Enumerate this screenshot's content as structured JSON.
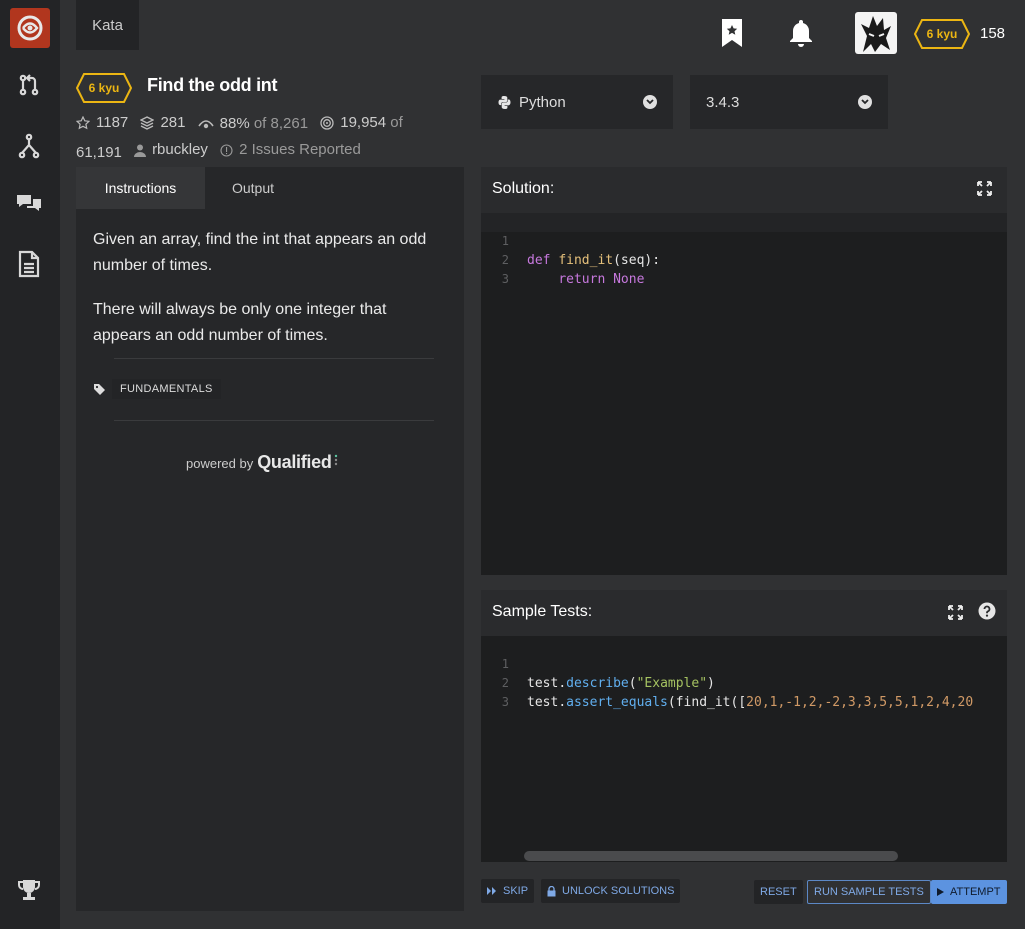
{
  "nav": {
    "kata_tab": "Kata",
    "honor": "158",
    "user_rank": "6 kyu"
  },
  "kata": {
    "rank": "6 kyu",
    "title": "Find the odd int",
    "stars": "1187",
    "collections": "281",
    "satisfaction": "88%",
    "satisfaction_of": "of 8,261",
    "completed": "19,954",
    "completed_of": "of",
    "total_attempts": "61,191",
    "author": "rbuckley",
    "issues": "2 Issues Reported"
  },
  "language": {
    "selected": "Python",
    "version": "3.4.3"
  },
  "instructions": {
    "tabs": [
      "Instructions",
      "Output"
    ],
    "paragraphs": [
      "Given an array, find the int that appears an odd number of times.",
      "There will always be only one integer that appears an odd number of times."
    ],
    "tag": "FUNDAMENTALS",
    "powered_by": "powered by",
    "powered_brand": "Qualified"
  },
  "solution": {
    "title": "Solution:",
    "line_numbers": [
      "1",
      "2",
      "3"
    ],
    "lines": [
      {
        "kw": "def",
        "fn": "find_it",
        "rest": "(seq):"
      },
      {
        "kw": "return",
        "rest": "None"
      }
    ]
  },
  "sample_tests": {
    "title": "Sample Tests:",
    "line_numbers": [
      "1",
      "2",
      "3"
    ],
    "line1": {
      "obj": "test",
      "dot": ".",
      "method": "describe",
      "open": "(",
      "str": "\"Example\"",
      "close": ")"
    },
    "line2": {
      "obj": "test",
      "dot": ".",
      "method": "assert_equals",
      "open": "(find_it([",
      "values": "20,1,-1,2,-2,3,3,5,5,1,2,4,20"
    }
  },
  "actions": {
    "skip": "SKIP",
    "unlock": "UNLOCK SOLUTIONS",
    "reset": "RESET",
    "run_tests": "RUN SAMPLE TESTS",
    "attempt": "ATTEMPT"
  },
  "colors": {
    "background": "#303133",
    "panel": "#262729",
    "editor": "#1d1e1f",
    "rank_yellow": "#ecb613",
    "accent_blue": "#5c93e0",
    "logo_red": "#b1361e"
  },
  "icons": [
    "codewars-logo",
    "pull-request-icon",
    "fork-icon",
    "chat-icon",
    "document-icon",
    "trophy-icon",
    "bookmark-icon",
    "bell-icon",
    "python-icon",
    "expand-icon",
    "help-icon",
    "skip-icon",
    "lock-icon",
    "play-icon"
  ]
}
